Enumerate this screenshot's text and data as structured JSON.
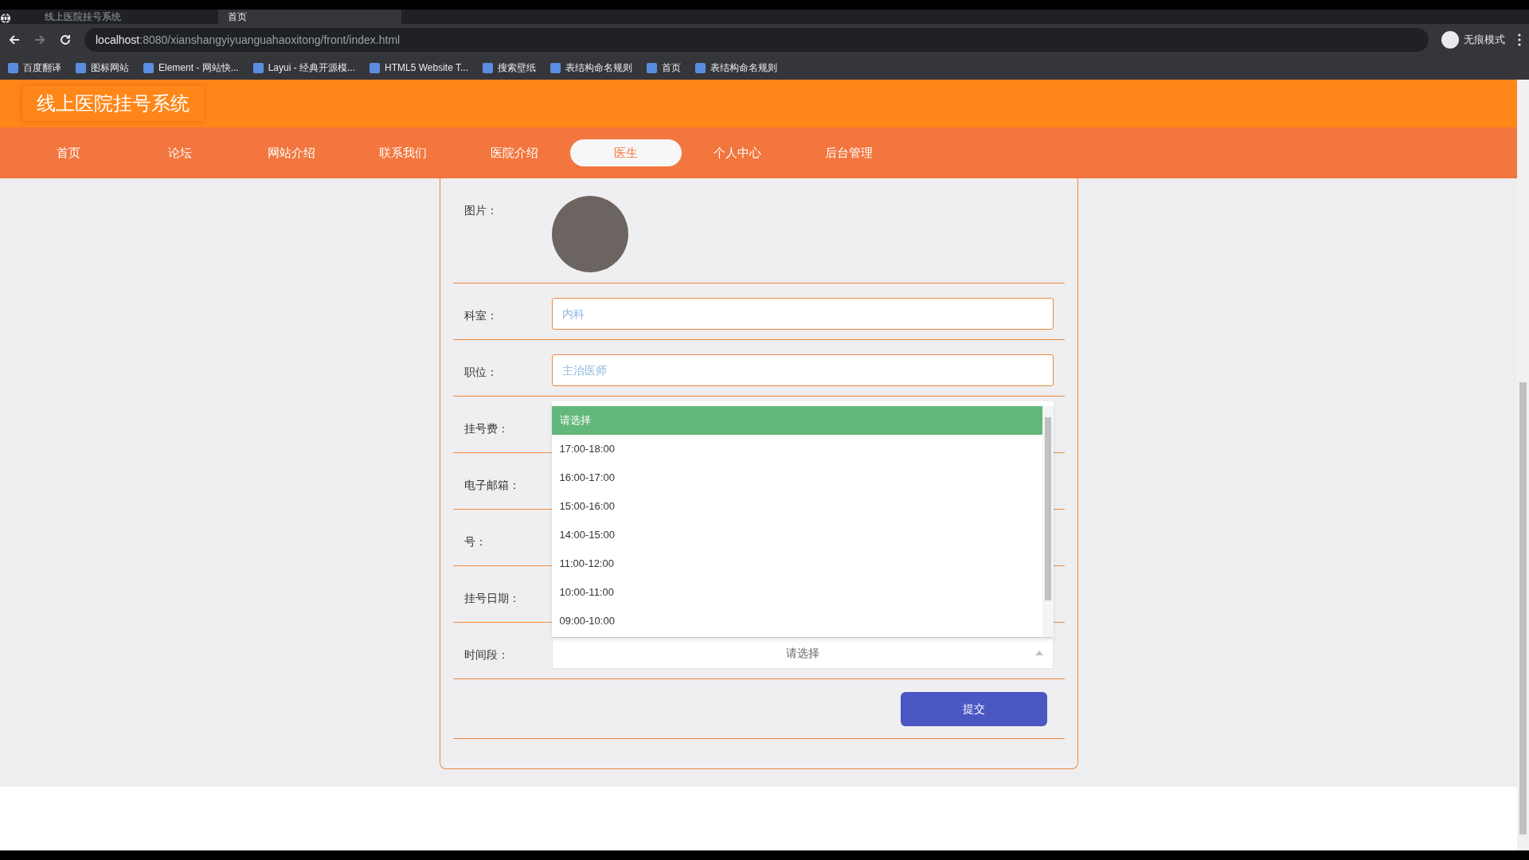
{
  "browser": {
    "tabs": [
      {
        "title": "线上医院挂号系统",
        "selected": false
      },
      {
        "title": "首页",
        "selected": true
      }
    ],
    "address": {
      "host": "localhost",
      "path": ":8080/xianshangyiyuanguahaoxitong/front/index.html"
    },
    "bookmarks": [
      "百度翻译",
      "图标网站",
      "Element - 网站快...",
      "Layui - 经典开源模...",
      "HTML5 Website T...",
      "搜索壁纸",
      "表结构命名规则",
      "首页",
      "表结构命名规则"
    ],
    "incognito": "无痕模式"
  },
  "site_title": "线上医院挂号系统",
  "nav": [
    {
      "label": "首页",
      "selected": false
    },
    {
      "label": "论坛",
      "selected": false
    },
    {
      "label": "网站介绍",
      "selected": false
    },
    {
      "label": "联系我们",
      "selected": false
    },
    {
      "label": "医院介绍",
      "selected": false
    },
    {
      "label": "医生",
      "selected": true
    },
    {
      "label": "个人中心",
      "selected": false
    },
    {
      "label": "后台管理",
      "selected": false
    }
  ],
  "form": {
    "rows": [
      {
        "kind": "image",
        "label": "图片："
      },
      {
        "kind": "text",
        "label": "科室：",
        "placeholder": "内科"
      },
      {
        "kind": "text",
        "label": "职位：",
        "placeholder": "主治医师"
      },
      {
        "kind": "covered",
        "label": "挂号费："
      },
      {
        "kind": "covered",
        "label": "电子邮箱："
      },
      {
        "kind": "covered",
        "label": "号："
      },
      {
        "kind": "covered",
        "label": "挂号日期："
      },
      {
        "kind": "select",
        "label": "时间段：",
        "value": "请选择",
        "expanded": true,
        "options": [
          {
            "label": "请选择",
            "selected": true
          },
          {
            "label": "17:00-18:00",
            "selected": false
          },
          {
            "label": "16:00-17:00",
            "selected": false
          },
          {
            "label": "15:00-16:00",
            "selected": false
          },
          {
            "label": "14:00-15:00",
            "selected": false
          },
          {
            "label": "11:00-12:00",
            "selected": false
          },
          {
            "label": "10:00-11:00",
            "selected": false
          },
          {
            "label": "09:00-10:00",
            "selected": false
          }
        ]
      }
    ],
    "submit": "提交"
  }
}
